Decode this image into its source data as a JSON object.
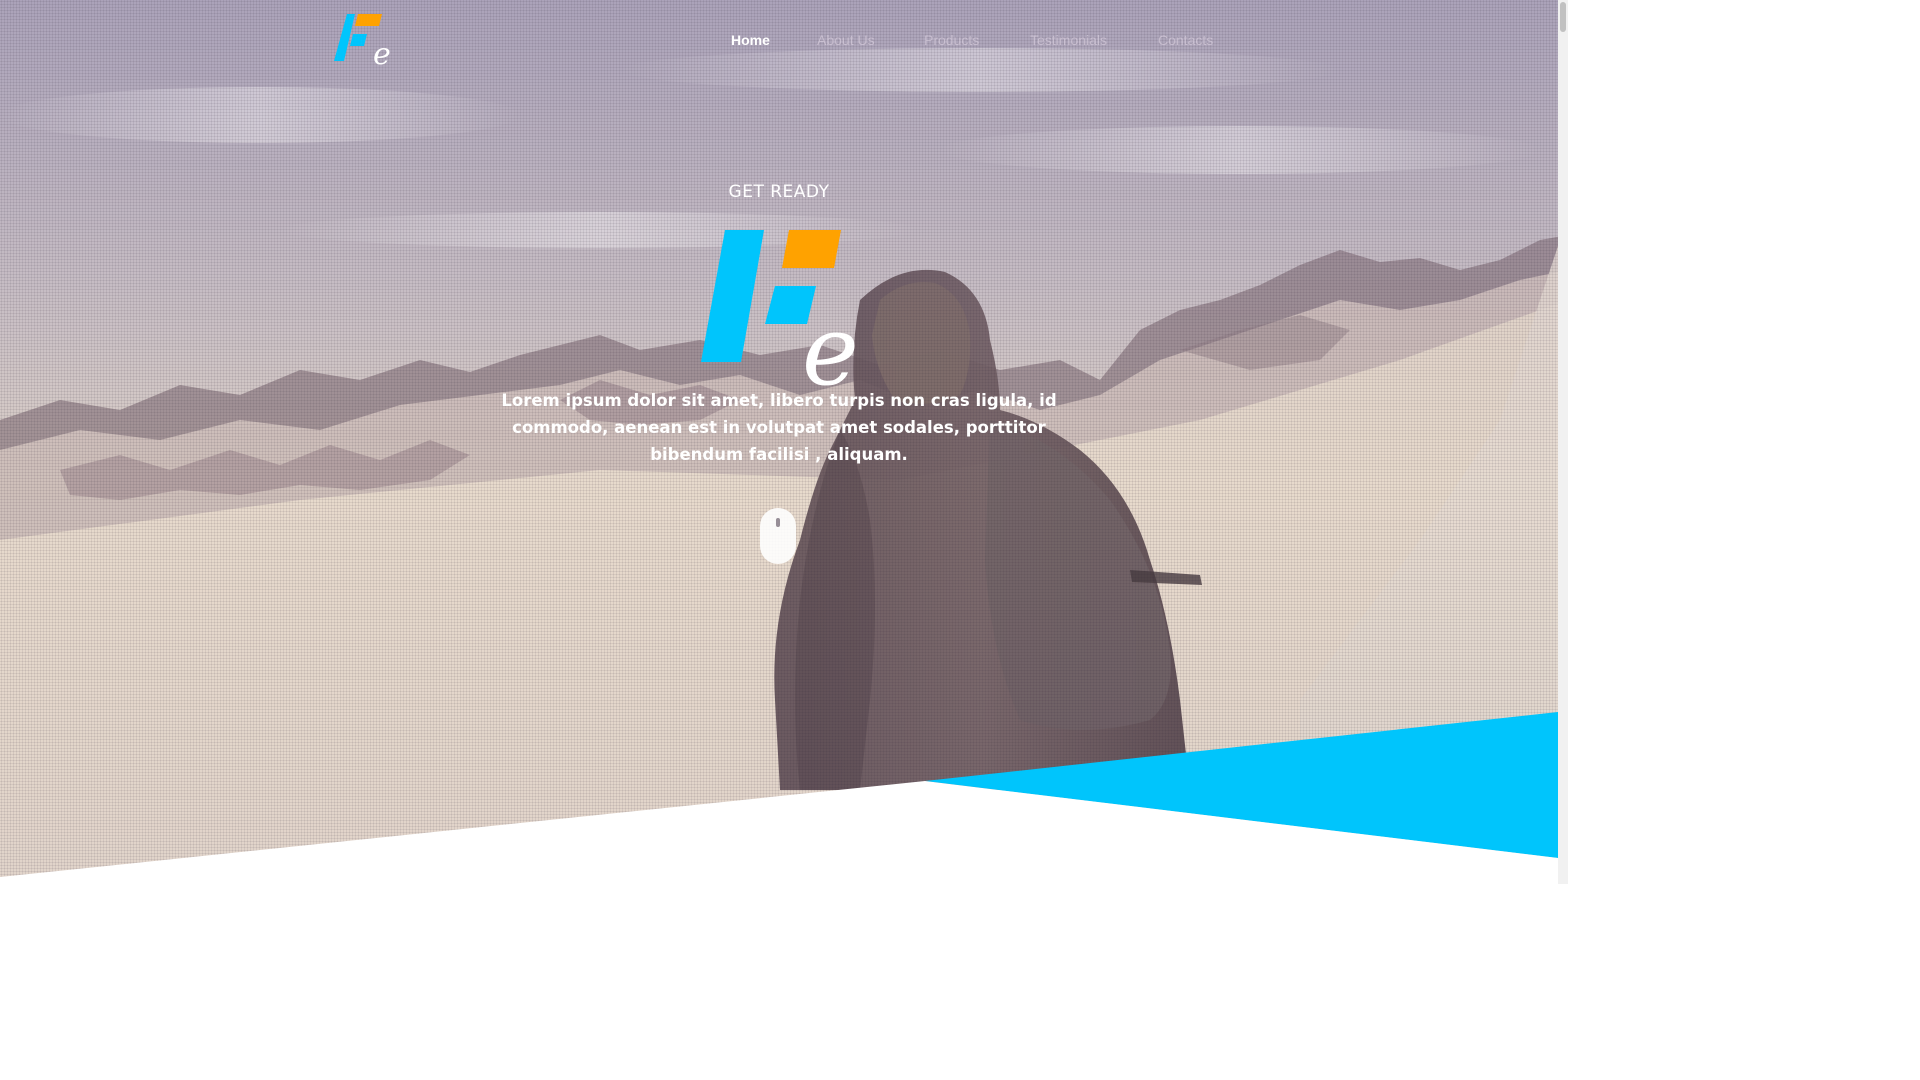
{
  "logo": {
    "alt": "Fe logo",
    "mark_letter": "e"
  },
  "nav": {
    "items": [
      {
        "label": "Home",
        "active": true
      },
      {
        "label": "About Us",
        "active": false
      },
      {
        "label": "Products",
        "active": false
      },
      {
        "label": "Testimonials",
        "active": false
      },
      {
        "label": "Contacts",
        "active": false
      }
    ]
  },
  "hero": {
    "eyebrow": "GET READY",
    "lead": "Lorem ipsum dolor sit amet, libero turpis non cras ligula, id commodo, aenean est in volutpat amet sodales, porttitor bibendum facilisi , aliquam.",
    "scroll_icon": "mouse-scroll-icon"
  },
  "colors": {
    "brand_blue": "#00c5fc",
    "brand_orange": "#ffa200",
    "white": "#ffffff"
  }
}
